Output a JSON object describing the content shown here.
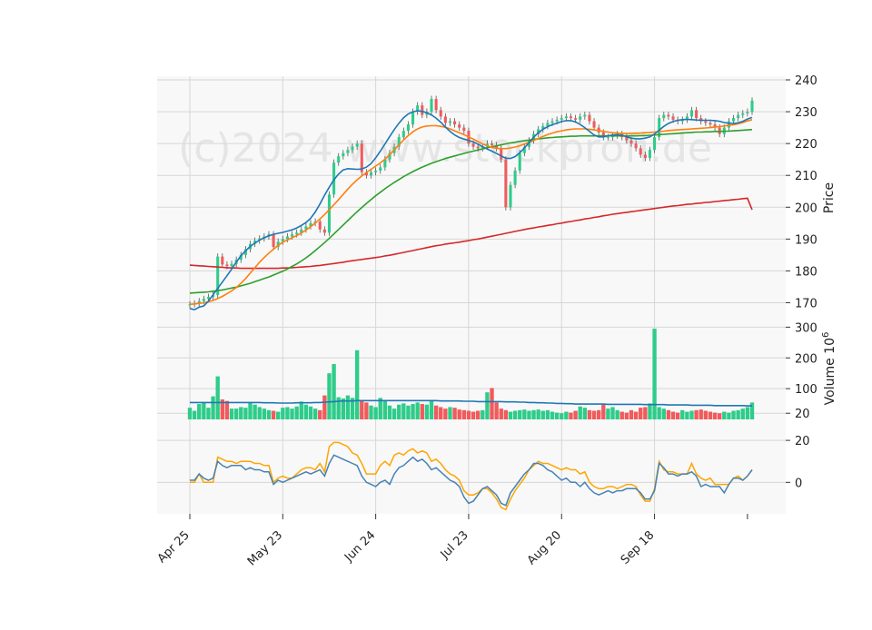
{
  "watermark": "(c)2024 www.stockprofi.de",
  "chart_data": {
    "type": "candlestick",
    "colors": {
      "up": "#2ecc8a",
      "down": "#f05b5b",
      "ma_a": "#1f77b4",
      "ma_b": "#ff7f0e",
      "ma_c": "#2ca02c",
      "ma_d": "#d62728",
      "volume_ma": "#1f77b4",
      "osc_a": "#4682b4",
      "osc_b": "#ffa500"
    },
    "x_ticks": [
      {
        "label": "Apr 25",
        "index": 0
      },
      {
        "label": "May 23",
        "index": 20
      },
      {
        "label": "Jun 24",
        "index": 40
      },
      {
        "label": "Jul 23",
        "index": 60
      },
      {
        "label": "Aug 20",
        "index": 80
      },
      {
        "label": "Sep 18",
        "index": 100
      }
    ],
    "x_extra_tick_index": 120,
    "price_panel": {
      "ylabel": "Price",
      "ylim": [
        165,
        240
      ],
      "yticks": [
        170,
        180,
        190,
        200,
        210,
        220,
        230,
        240
      ],
      "close": [
        169.5,
        169.8,
        170.5,
        171.2,
        171.8,
        172.4,
        184.5,
        182.0,
        181.5,
        182.2,
        183.5,
        185.0,
        186.8,
        188.5,
        189.5,
        190.2,
        190.8,
        191.5,
        187.5,
        189.2,
        190.0,
        190.8,
        191.5,
        192.0,
        193.0,
        194.0,
        195.0,
        195.5,
        193.0,
        192.0,
        204.0,
        214.0,
        216.0,
        217.0,
        218.0,
        219.0,
        220.0,
        211.0,
        210.0,
        211.0,
        211.5,
        212.5,
        215.0,
        217.0,
        219.0,
        222.0,
        224.0,
        226.0,
        230.0,
        232.0,
        229.0,
        230.0,
        234.0,
        230.5,
        228.5,
        226.5,
        227.0,
        226.0,
        225.0,
        224.0,
        220.0,
        219.0,
        218.5,
        219.0,
        220.0,
        219.5,
        218.5,
        215.0,
        200.0,
        207.0,
        211.5,
        217.0,
        219.0,
        221.0,
        223.0,
        224.5,
        225.5,
        226.5,
        227.0,
        227.5,
        228.0,
        228.5,
        228.0,
        227.5,
        228.5,
        229.0,
        227.0,
        225.0,
        223.5,
        222.0,
        222.0,
        222.5,
        223.0,
        222.0,
        221.0,
        220.0,
        218.5,
        216.5,
        215.5,
        218.0,
        222.0,
        228.0,
        229.0,
        228.5,
        227.5,
        227.0,
        227.5,
        228.5,
        230.5,
        228.0,
        227.0,
        226.5,
        226.0,
        225.0,
        223.0,
        225.0,
        227.0,
        228.0,
        229.0,
        229.5,
        230.0,
        233.5
      ],
      "ma_a": [
        168.2,
        167.8,
        168.6,
        169.0,
        170.5,
        172.5,
        174.5,
        176.5,
        178.5,
        180.5,
        182.8,
        184.8,
        186.3,
        187.7,
        188.7,
        189.7,
        190.4,
        191.0,
        191.5,
        191.8,
        192.1,
        192.5,
        192.9,
        193.5,
        194.3,
        195.2,
        196.5,
        198.5,
        201.0,
        203.8,
        206.3,
        208.6,
        210.4,
        211.7,
        212.1,
        212.0,
        211.9,
        212.0,
        212.6,
        213.7,
        215.5,
        217.6,
        219.9,
        222.2,
        224.4,
        226.4,
        228.1,
        229.3,
        230.0,
        230.3,
        230.1,
        229.7,
        229.0,
        228.0,
        226.7,
        225.2,
        223.8,
        222.7,
        221.9,
        221.4,
        221.0,
        220.5,
        219.8,
        219.0,
        218.3,
        217.6,
        216.9,
        216.1,
        215.4,
        215.3,
        215.9,
        217.1,
        218.6,
        220.3,
        222.0,
        223.4,
        224.5,
        225.3,
        225.9,
        226.4,
        226.9,
        227.2,
        227.2,
        226.8,
        226.0,
        225.0,
        223.8,
        222.7,
        222.1,
        222.1,
        222.4,
        222.7,
        222.8,
        222.6,
        222.1,
        221.7,
        221.5,
        221.5,
        221.7,
        222.1,
        223.0,
        224.2,
        225.4,
        226.3,
        226.9,
        227.3,
        227.5,
        227.6,
        227.5,
        227.4,
        227.3,
        227.3,
        227.3,
        227.2,
        227.0,
        226.6,
        226.4,
        226.3,
        226.5,
        227.0,
        227.7,
        228.2
      ],
      "ma_b": [
        169.5,
        169.6,
        169.8,
        170.0,
        170.3,
        170.7,
        171.3,
        172.0,
        172.8,
        173.7,
        174.8,
        176.1,
        177.6,
        179.3,
        181.0,
        182.7,
        184.2,
        185.6,
        186.8,
        188.0,
        189.0,
        189.7,
        190.4,
        191.1,
        191.9,
        192.8,
        193.9,
        195.0,
        196.3,
        197.7,
        199.2,
        200.8,
        202.4,
        204.0,
        205.7,
        207.2,
        208.6,
        209.8,
        210.9,
        211.9,
        212.9,
        213.9,
        215.1,
        216.5,
        218.0,
        219.6,
        221.1,
        222.5,
        223.7,
        224.6,
        225.2,
        225.5,
        225.6,
        225.6,
        225.4,
        225.1,
        224.6,
        224.0,
        223.4,
        222.8,
        222.1,
        221.4,
        220.6,
        219.9,
        219.3,
        218.8,
        218.5,
        218.4,
        218.4,
        218.6,
        218.9,
        219.3,
        219.8,
        220.4,
        221.0,
        221.6,
        222.2,
        222.8,
        223.3,
        223.7,
        224.0,
        224.3,
        224.5,
        224.6,
        224.6,
        224.6,
        224.5,
        224.3,
        224.1,
        223.8,
        223.6,
        223.4,
        223.3,
        223.2,
        223.2,
        223.2,
        223.2,
        223.3,
        223.4,
        223.5,
        223.6,
        223.8,
        223.9,
        224.1,
        224.2,
        224.3,
        224.4,
        224.5,
        224.6,
        224.7,
        224.8,
        224.9,
        225.0,
        225.2,
        225.3,
        225.5,
        225.7,
        225.9,
        226.2,
        226.6,
        227.1,
        227.5
      ],
      "ma_c": [
        173.0,
        173.1,
        173.2,
        173.3,
        173.4,
        173.6,
        173.8,
        174.0,
        174.3,
        174.6,
        174.9,
        175.3,
        175.7,
        176.1,
        176.6,
        177.1,
        177.6,
        178.1,
        178.7,
        179.3,
        179.9,
        180.6,
        181.4,
        182.2,
        183.1,
        184.1,
        185.2,
        186.4,
        187.6,
        188.9,
        190.2,
        191.6,
        193.0,
        194.4,
        195.8,
        197.2,
        198.6,
        199.9,
        201.2,
        202.4,
        203.6,
        204.7,
        205.8,
        206.8,
        207.8,
        208.7,
        209.6,
        210.4,
        211.2,
        211.9,
        212.6,
        213.2,
        213.8,
        214.3,
        214.8,
        215.3,
        215.7,
        216.1,
        216.5,
        216.9,
        217.3,
        217.6,
        218.0,
        218.3,
        218.7,
        219.0,
        219.3,
        219.6,
        219.9,
        220.2,
        220.4,
        220.7,
        220.9,
        221.1,
        221.3,
        221.5,
        221.6,
        221.8,
        221.9,
        222.0,
        222.1,
        222.2,
        222.3,
        222.3,
        222.4,
        222.4,
        222.4,
        222.4,
        222.4,
        222.4,
        222.4,
        222.4,
        222.4,
        222.4,
        222.4,
        222.4,
        222.4,
        222.5,
        222.5,
        222.6,
        222.7,
        222.8,
        222.9,
        223.0,
        223.1,
        223.2,
        223.3,
        223.4,
        223.5,
        223.6,
        223.6,
        223.7,
        223.7,
        223.8,
        223.8,
        223.9,
        223.9,
        224.0,
        224.1,
        224.2,
        224.3,
        224.4
      ],
      "ma_d": [
        181.8,
        181.7,
        181.6,
        181.5,
        181.4,
        181.3,
        181.2,
        181.1,
        181.0,
        180.9,
        180.9,
        180.8,
        180.8,
        180.8,
        180.8,
        180.8,
        180.8,
        180.8,
        180.8,
        180.8,
        180.9,
        180.9,
        181.0,
        181.1,
        181.2,
        181.3,
        181.4,
        181.6,
        181.7,
        181.9,
        182.1,
        182.3,
        182.5,
        182.7,
        183.0,
        183.2,
        183.4,
        183.6,
        183.8,
        184.0,
        184.2,
        184.4,
        184.7,
        184.9,
        185.2,
        185.5,
        185.8,
        186.1,
        186.4,
        186.7,
        187.0,
        187.3,
        187.6,
        187.9,
        188.1,
        188.4,
        188.6,
        188.8,
        189.0,
        189.3,
        189.5,
        189.8,
        190.0,
        190.3,
        190.6,
        190.9,
        191.2,
        191.5,
        191.8,
        192.1,
        192.4,
        192.7,
        193.0,
        193.3,
        193.5,
        193.8,
        194.0,
        194.3,
        194.5,
        194.8,
        195.0,
        195.3,
        195.5,
        195.8,
        196.0,
        196.3,
        196.5,
        196.8,
        197.0,
        197.3,
        197.5,
        197.8,
        198.0,
        198.2,
        198.4,
        198.6,
        198.8,
        199.0,
        199.2,
        199.4,
        199.6,
        199.8,
        200.0,
        200.2,
        200.4,
        200.5,
        200.7,
        200.9,
        201.0,
        201.2,
        201.3,
        201.5,
        201.6,
        201.8,
        201.9,
        202.1,
        202.2,
        202.4,
        202.5,
        202.7,
        202.8,
        199.2
      ]
    },
    "volume_panel": {
      "ylabel": "Volume  10",
      "ylabel_exponent": "6",
      "ylim": [
        0,
        310
      ],
      "yticks": [
        20,
        100,
        200,
        300
      ],
      "values": [
        38,
        28,
        50,
        55,
        38,
        75,
        140,
        65,
        60,
        35,
        35,
        40,
        38,
        55,
        48,
        40,
        35,
        30,
        28,
        25,
        38,
        40,
        35,
        42,
        58,
        48,
        42,
        35,
        30,
        78,
        150,
        180,
        72,
        68,
        78,
        70,
        225,
        62,
        55,
        45,
        40,
        70,
        62,
        45,
        35,
        48,
        52,
        45,
        50,
        55,
        50,
        48,
        60,
        45,
        40,
        35,
        40,
        38,
        32,
        30,
        28,
        25,
        28,
        30,
        88,
        102,
        55,
        35,
        30,
        25,
        28,
        30,
        32,
        28,
        30,
        32,
        28,
        30,
        25,
        22,
        20,
        25,
        22,
        28,
        42,
        38,
        30,
        28,
        30,
        48,
        35,
        40,
        30,
        25,
        22,
        30,
        25,
        38,
        40,
        52,
        295,
        40,
        35,
        30,
        25,
        22,
        30,
        25,
        28,
        30,
        32,
        28,
        25,
        22,
        20,
        25,
        22,
        28,
        30,
        35,
        40,
        55
      ],
      "ma": [
        55,
        55,
        55,
        55,
        55,
        55,
        55,
        55,
        55,
        55,
        55,
        55,
        55,
        55,
        55,
        55,
        54,
        54,
        54,
        53,
        53,
        53,
        53,
        54,
        54,
        54,
        54,
        55,
        55,
        56,
        57,
        58,
        59,
        60,
        60,
        60,
        61,
        61,
        61,
        61,
        61,
        61,
        61,
        61,
        61,
        61,
        61,
        61,
        61,
        61,
        61,
        61,
        61,
        61,
        60,
        60,
        60,
        60,
        60,
        59,
        59,
        59,
        58,
        58,
        58,
        58,
        58,
        58,
        57,
        57,
        57,
        56,
        56,
        55,
        55,
        54,
        54,
        53,
        53,
        52,
        52,
        51,
        51,
        50,
        50,
        50,
        50,
        50,
        50,
        50,
        49,
        49,
        49,
        49,
        49,
        49,
        49,
        49,
        48,
        48,
        48,
        48,
        48,
        47,
        47,
        47,
        47,
        47,
        46,
        46,
        46,
        46,
        46,
        45,
        45,
        45,
        45,
        45,
        45,
        45,
        44,
        44
      ]
    },
    "oscillator_panel": {
      "ylim": [
        -15,
        30
      ],
      "yticks": [
        0,
        20
      ],
      "line_a": [
        1,
        1,
        4,
        2,
        1,
        2,
        10,
        8,
        7,
        8,
        8,
        8,
        6,
        7,
        6,
        6,
        5,
        5,
        -1,
        1,
        0,
        1,
        2,
        3,
        4,
        5,
        4,
        5,
        6,
        3,
        9,
        13,
        12,
        11,
        10,
        9,
        8,
        3,
        0,
        -1,
        -2,
        0,
        1,
        -1,
        4,
        7,
        8,
        10,
        12,
        10,
        11,
        9,
        6,
        7,
        5,
        3,
        1,
        0,
        -2,
        -7,
        -10,
        -9,
        -6,
        -3,
        -2,
        -4,
        -6,
        -10,
        -11,
        -5,
        -2,
        1,
        4,
        6,
        9,
        9,
        8,
        6,
        5,
        3,
        1,
        2,
        0,
        0,
        -2,
        0,
        -3,
        -5,
        -6,
        -5,
        -4,
        -5,
        -4,
        -4,
        -3,
        -3,
        -3,
        -5,
        -8,
        -8,
        -4,
        9,
        7,
        4,
        4,
        3,
        4,
        4,
        5,
        3,
        -2,
        -1,
        -2,
        -2,
        -2,
        -5,
        -1,
        2,
        2,
        1,
        3,
        6
      ],
      "line_b": [
        0,
        0,
        4,
        0,
        0,
        0,
        12,
        11,
        10,
        10,
        9,
        10,
        10,
        10,
        9,
        9,
        8,
        8,
        0,
        2,
        3,
        2,
        2,
        4,
        6,
        7,
        7,
        6,
        9,
        5,
        17,
        19,
        19,
        18,
        17,
        14,
        13,
        9,
        4,
        4,
        4,
        8,
        10,
        8,
        13,
        14,
        13,
        15,
        16,
        14,
        15,
        14,
        10,
        11,
        9,
        6,
        4,
        3,
        1,
        -4,
        -6,
        -6,
        -5,
        -3,
        -3,
        -5,
        -8,
        -12,
        -13,
        -8,
        -4,
        -1,
        2,
        6,
        8,
        10,
        9,
        9,
        8,
        7,
        6,
        7,
        6,
        6,
        4,
        5,
        0,
        -2,
        -3,
        -3,
        -2,
        -2,
        -3,
        -2,
        -1,
        -1,
        -2,
        -6,
        -9,
        -9,
        -3,
        10,
        6,
        5,
        5,
        4,
        4,
        4,
        9,
        4,
        2,
        1,
        2,
        -1,
        -1,
        -1,
        -1,
        2,
        3,
        1,
        3,
        6
      ]
    }
  }
}
